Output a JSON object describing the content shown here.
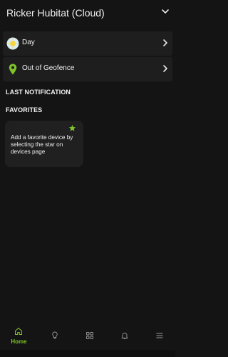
{
  "header": {
    "title": "Ricker Hubitat (Cloud)"
  },
  "rows": [
    {
      "label": "Day",
      "icon": "sun-icon"
    },
    {
      "label": "Out of Geofence",
      "icon": "location-pin-icon"
    }
  ],
  "sections": {
    "last_notification": "LAST NOTIFICATION",
    "favorites": "FAVORITES"
  },
  "favorites_card": {
    "text": "Add a favorite device by selecting the star on devices page",
    "icon": "star-icon"
  },
  "nav": {
    "home_label": "Home",
    "items": [
      "home-icon",
      "lightbulb-icon",
      "grid-icon",
      "bell-icon",
      "menu-icon"
    ]
  },
  "colors": {
    "accent": "#7ec42a",
    "background": "#141414",
    "card": "#1e1e1e"
  }
}
